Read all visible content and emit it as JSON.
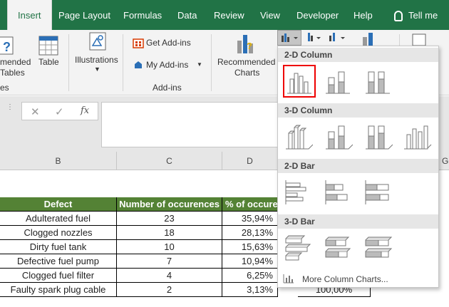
{
  "ribbon_tabs": {
    "insert": "Insert",
    "page_layout": "Page Layout",
    "formulas": "Formulas",
    "data": "Data",
    "review": "Review",
    "view": "View",
    "developer": "Developer",
    "help": "Help",
    "tell_me": "Tell me wh"
  },
  "ribbon": {
    "pivot_line1": "mended",
    "pivot_line2": "Tables",
    "table": "Table",
    "tables_group": "es",
    "illustrations": "Illustrations",
    "get_addins": "Get Add-ins",
    "my_addins": "My Add-ins",
    "addins_group": "Add-ins",
    "rec_charts_line1": "Recommended",
    "rec_charts_line2": "Charts"
  },
  "formula_bar": {
    "cancel": "✕",
    "enter": "✓",
    "fx": "fx"
  },
  "columns": [
    "B",
    "C",
    "D",
    "G"
  ],
  "table": {
    "headers": [
      "Defect",
      "Number of occurences",
      "% of occurer"
    ],
    "rows": [
      [
        "Adulterated fuel",
        "23",
        "35,94%"
      ],
      [
        "Clogged nozzles",
        "18",
        "28,13%"
      ],
      [
        "Dirty fuel tank",
        "10",
        "15,63%"
      ],
      [
        "Defective fuel pump",
        "7",
        "10,94%"
      ],
      [
        "Clogged fuel filter",
        "4",
        "6,25%"
      ],
      [
        "Faulty spark plug cable",
        "2",
        "3,13%"
      ]
    ],
    "cumulative_partial": "100,00%"
  },
  "dropdown": {
    "sections": [
      "2-D Column",
      "3-D Column",
      "2-D Bar",
      "3-D Bar"
    ],
    "more_link": "More Column Charts..."
  },
  "colors": {
    "excel_green": "#217346",
    "header_green": "#548235",
    "selection_red": "#e00000"
  }
}
